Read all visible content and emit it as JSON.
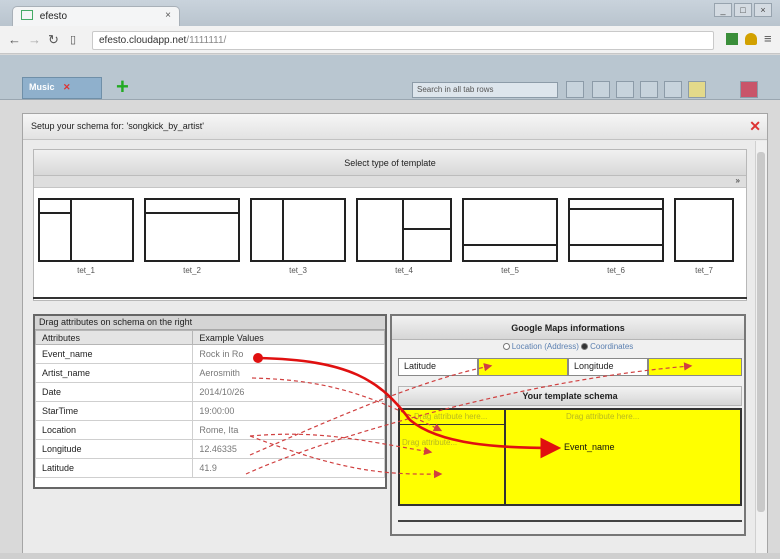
{
  "browser": {
    "tab_title": "efesto",
    "tab_close": "×",
    "url_host": "efesto.cloudapp.net",
    "url_path": "/1111111/"
  },
  "app": {
    "tab_label": "Music",
    "tab_close": "✕",
    "add_tab": "+",
    "search_placeholder": "Search in all tab rows"
  },
  "dialog": {
    "title": "Setup your schema for: 'songkick_by_artist'",
    "close": "✕",
    "template_header": "Select type of template",
    "templates": [
      {
        "label": "tet_1"
      },
      {
        "label": "tet_2"
      },
      {
        "label": "tet_3"
      },
      {
        "label": "tet_4"
      },
      {
        "label": "tet_5"
      },
      {
        "label": "tet_6"
      },
      {
        "label": "tet_7"
      }
    ],
    "attributes_caption": "Drag attributes on schema on the right",
    "attributes_columns": [
      "Attributes",
      "Example Values"
    ],
    "attributes": [
      {
        "name": "Event_name",
        "example": "Rock in Ro"
      },
      {
        "name": "Artist_name",
        "example": "Aerosmith"
      },
      {
        "name": "Date",
        "example": "2014/10/26"
      },
      {
        "name": "StarTime",
        "example": "19:00:00"
      },
      {
        "name": "Location",
        "example": "Rome, Ita"
      },
      {
        "name": "Longitude",
        "example": "12.46335"
      },
      {
        "name": "Latitude",
        "example": "41.9"
      }
    ],
    "maps_header": "Google Maps informations",
    "radio_location": "Location (Address)",
    "radio_coordinates": "Coordinates",
    "latitude_label": "Latitude",
    "longitude_label": "Longitude",
    "schema_header": "Your template schema",
    "drop_hint_1": "Drag attribute here...",
    "drop_hint_2": "Drag attribute here...",
    "drop_hint_3": "Drag attribute...",
    "dropped_attribute": "Event_name"
  },
  "colors": {
    "drop_zone": "#ffff00",
    "drag_arrow": "#e01010",
    "hint_arrow": "#d04040"
  }
}
